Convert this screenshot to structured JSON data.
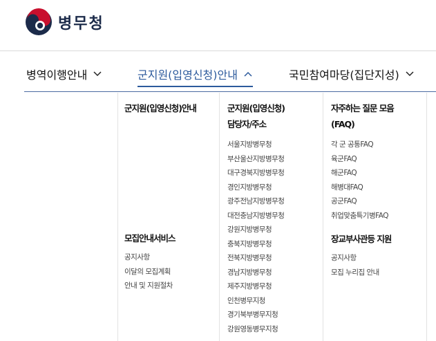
{
  "header": {
    "logo_text": "병무청"
  },
  "nav": {
    "items": [
      {
        "label": "병역이행안내"
      },
      {
        "label": "군지원(입영신청)안내"
      },
      {
        "label": "국민참여마당(집단지성)"
      }
    ]
  },
  "menu": {
    "col1": {
      "title": "군지원(입영신청)안내",
      "section2_title": "모집안내서비스",
      "section2_items": [
        "공지사항",
        "이달의 모집계획",
        "안내 및 지원절차"
      ]
    },
    "col2": {
      "title_line1": "군지원(입영신청)",
      "title_line2": "담당자/주소",
      "items": [
        "서울지방병무청",
        "부산울산지방병무청",
        "대구경북지방병무청",
        "경인지방병무청",
        "광주전남지방병무청",
        "대전충남지방병무청",
        "강원지방병무청",
        "충북지방병무청",
        "전북지방병무청",
        "경남지방병무청",
        "제주지방병무청",
        "인천병무지청",
        "경기북부병무지청",
        "강원영동병무지청"
      ]
    },
    "col3": {
      "title_line1": "자주하는 질문 모음",
      "title_line2": "(FAQ)",
      "items": [
        "각 군 공통FAQ",
        "육군FAQ",
        "해군FAQ",
        "해병대FAQ",
        "공군FAQ",
        "취업맞춤특기병FAQ"
      ],
      "section2_title": "장교부사관등 지원",
      "section2_items": [
        "공지사항",
        "모집 누리집 안내"
      ]
    }
  },
  "colors": {
    "accent": "#2c5a9c",
    "logo_red": "#c8102e",
    "logo_navy": "#1c2b4a"
  }
}
